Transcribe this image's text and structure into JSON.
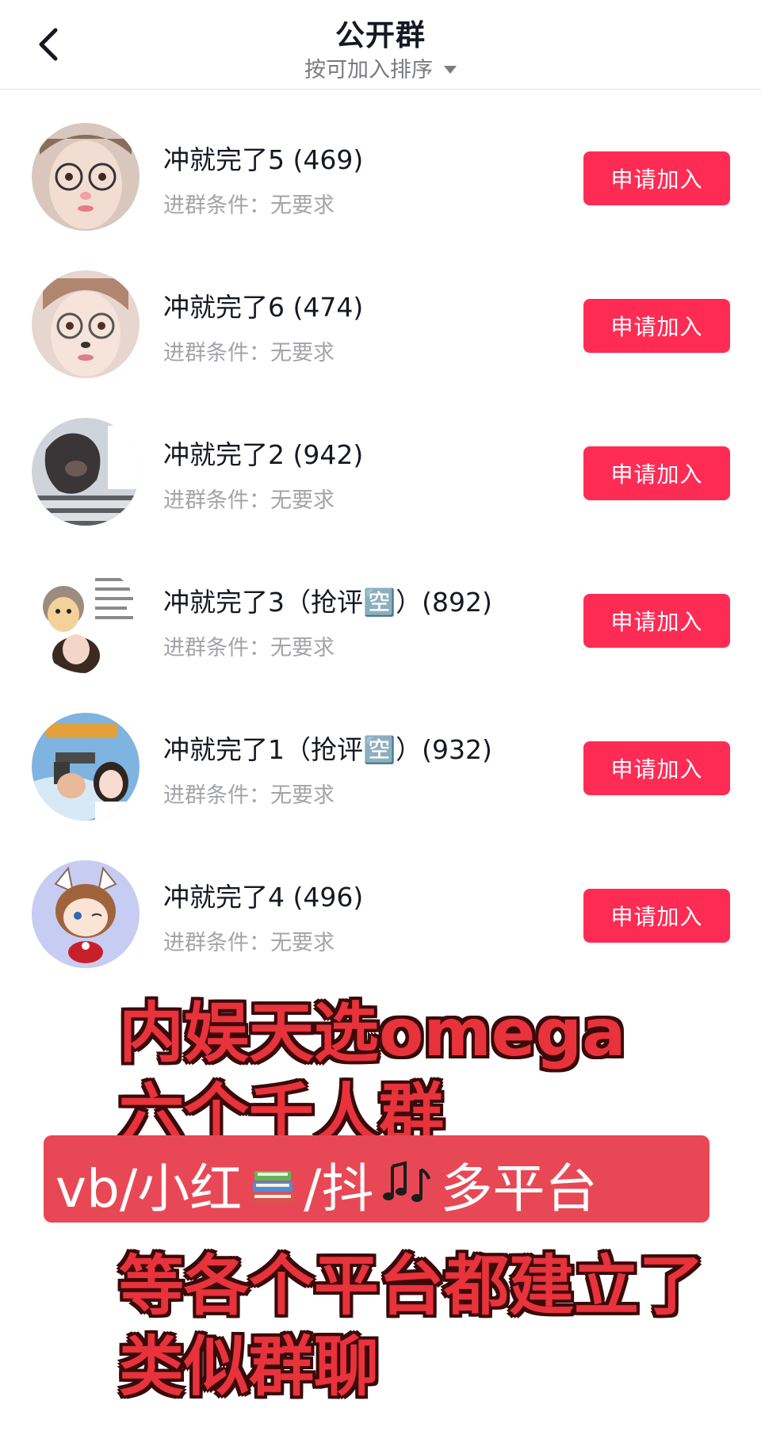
{
  "header": {
    "title": "公开群",
    "sort_label": "按可加入排序",
    "icons": {
      "back": "chevron-left-icon",
      "sort": "caret-down-icon"
    }
  },
  "groups": [
    {
      "name": "冲就完了5 (469)",
      "condition": "进群条件：无要求",
      "button": "申请加入"
    },
    {
      "name": "冲就完了6 (474)",
      "condition": "进群条件：无要求",
      "button": "申请加入"
    },
    {
      "name": "冲就完了2 (942)",
      "condition": "进群条件：无要求",
      "button": "申请加入"
    },
    {
      "name": "冲就完了3（抢评🈳）(892)",
      "condition": "进群条件：无要求",
      "button": "申请加入"
    },
    {
      "name": "冲就完了1（抢评🈳）(932)",
      "condition": "进群条件：无要求",
      "button": "申请加入"
    },
    {
      "name": "冲就完了4 (496)",
      "condition": "进群条件：无要求",
      "button": "申请加入"
    }
  ],
  "overlay": {
    "line1": "内娱天选omega",
    "line2": "六个千人群",
    "banner_left": "vb/小红",
    "banner_mid": "/抖",
    "banner_right": "多平台",
    "line4": "等各个平台都建立了",
    "line5": "类似群聊",
    "colors": {
      "accent": "#fe2c55",
      "overlay_text": "#e8323c",
      "banner": "#e84855"
    }
  }
}
